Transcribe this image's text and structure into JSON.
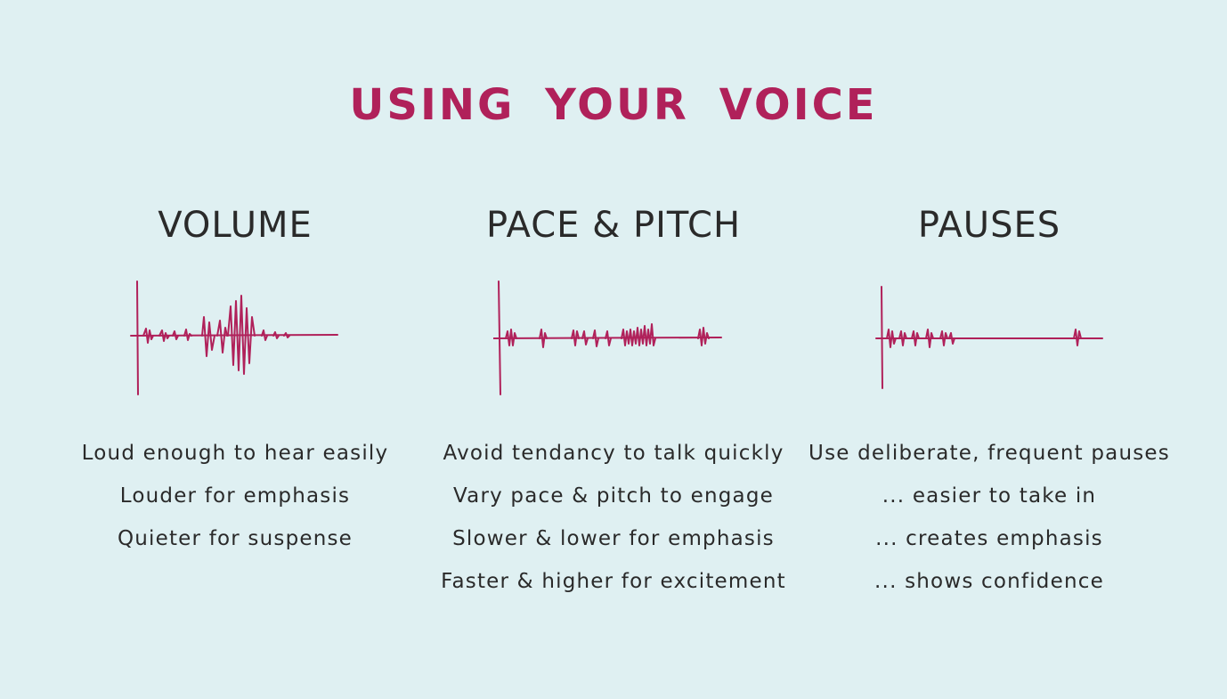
{
  "title": "USING YOUR VOICE",
  "accent_color": "#b0215a",
  "text_color": "#2a2a2a",
  "background_color": "#dff0f2",
  "columns": [
    {
      "heading": "VOLUME",
      "icon": "sound-waveform-icon",
      "lines": [
        "Loud enough to hear easily",
        "Louder for emphasis",
        "Quieter for suspense"
      ]
    },
    {
      "heading": "PACE & PITCH",
      "icon": "sound-waveform-icon",
      "lines": [
        "Avoid tendancy to talk quickly",
        "Vary pace & pitch to engage",
        "Slower & lower for emphasis",
        "Faster & higher for excitement"
      ]
    },
    {
      "heading": "PAUSES",
      "icon": "sound-waveform-icon",
      "lines": [
        "Use deliberate, frequent pauses",
        "... easier to take in",
        "... creates emphasis",
        "... shows confidence"
      ]
    }
  ]
}
